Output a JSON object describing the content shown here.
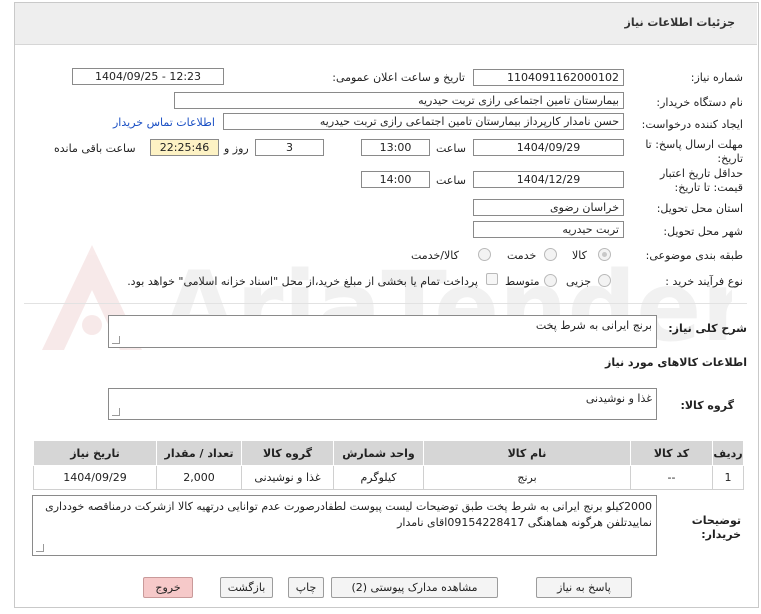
{
  "header": {
    "title": "جزئیات اطلاعات نیاز"
  },
  "watermark": {
    "text": "AriaTender.neT"
  },
  "form": {
    "need_number_label": "شماره نیاز:",
    "need_number": "1104091162000102",
    "announce_label": "تاریخ و ساعت اعلان عمومی:",
    "announce_value": "1404/09/25 - 12:23",
    "buyer_label": "نام دستگاه خریدار:",
    "buyer_value": "بیمارستان تامین اجتماعی رازی تربت حیدریه",
    "creator_label": "ایجاد کننده درخواست:",
    "creator_value": "حسن نامدار کارپرداز بیمارستان تامین اجتماعی رازی تربت حیدریه",
    "contact_link": "اطلاعات تماس خریدار",
    "reply_deadline_label": "مهلت ارسال پاسخ: تا تاریخ:",
    "reply_date": "1404/09/29",
    "time_label": "ساعت",
    "reply_time": "13:00",
    "days_value": "3",
    "days_label": "روز و",
    "remaining_time": "22:25:46",
    "remaining_label": "ساعت باقی مانده",
    "validity_label": "حداقل تاریخ اعتبار قیمت: تا تاریخ:",
    "validity_date": "1404/12/29",
    "validity_time": "14:00",
    "province_label": "استان محل تحویل:",
    "province_value": "خراسان رضوی",
    "city_label": "شهر محل تحویل:",
    "city_value": "تربت حیدریه",
    "category_label": "طبقه بندی موضوعی:",
    "category_options": [
      "کالا",
      "خدمت",
      "کالا/خدمت"
    ],
    "category_selected": "کالا",
    "process_label": "نوع فرآیند خرید :",
    "process_options": [
      "جزیی",
      "متوسط"
    ],
    "payment_note": "پرداخت تمام یا بخشی از مبلغ خرید،از محل \"اسناد خزانه اسلامی\" خواهد بود."
  },
  "summary": {
    "label": "شرح کلی نیاز:",
    "value": "برنج ایرانی به شرط پخت"
  },
  "goods_section": {
    "title": "اطلاعات کالاهای مورد نیاز",
    "group_label": "گروه کالا:",
    "group_value": "غذا و نوشیدنی"
  },
  "table": {
    "headers": [
      "ردیف",
      "کد کالا",
      "نام کالا",
      "واحد شمارش",
      "گروه کالا",
      "تعداد / مقدار",
      "تاریخ نیاز"
    ],
    "rows": [
      [
        "1",
        "--",
        "برنج",
        "کیلوگرم",
        "غذا و نوشیدنی",
        "2,000",
        "1404/09/29"
      ]
    ]
  },
  "buyer_notes": {
    "label": "توضیحات خریدار:",
    "text": "2000کیلو برنج ایرانی به شرط پخت طبق توضیحات لیست پیوست لطفادرصورت عدم توانایی درتهیه کالا ازشرکت درمناقصه خودداری نماییدتلفن هرگونه هماهنگی 09154228417اقای نامدار"
  },
  "buttons": {
    "reply": "پاسخ به نیاز",
    "view_docs": "مشاهده مدارک پیوستی (2)",
    "print": "چاپ",
    "back": "بازگشت",
    "exit": "خروج"
  },
  "colors": {
    "header_bg": "#eeeeee",
    "time_highlight": "#fdf2c4",
    "link": "#1a4fc4",
    "exit_button": "#f6c9c9"
  }
}
